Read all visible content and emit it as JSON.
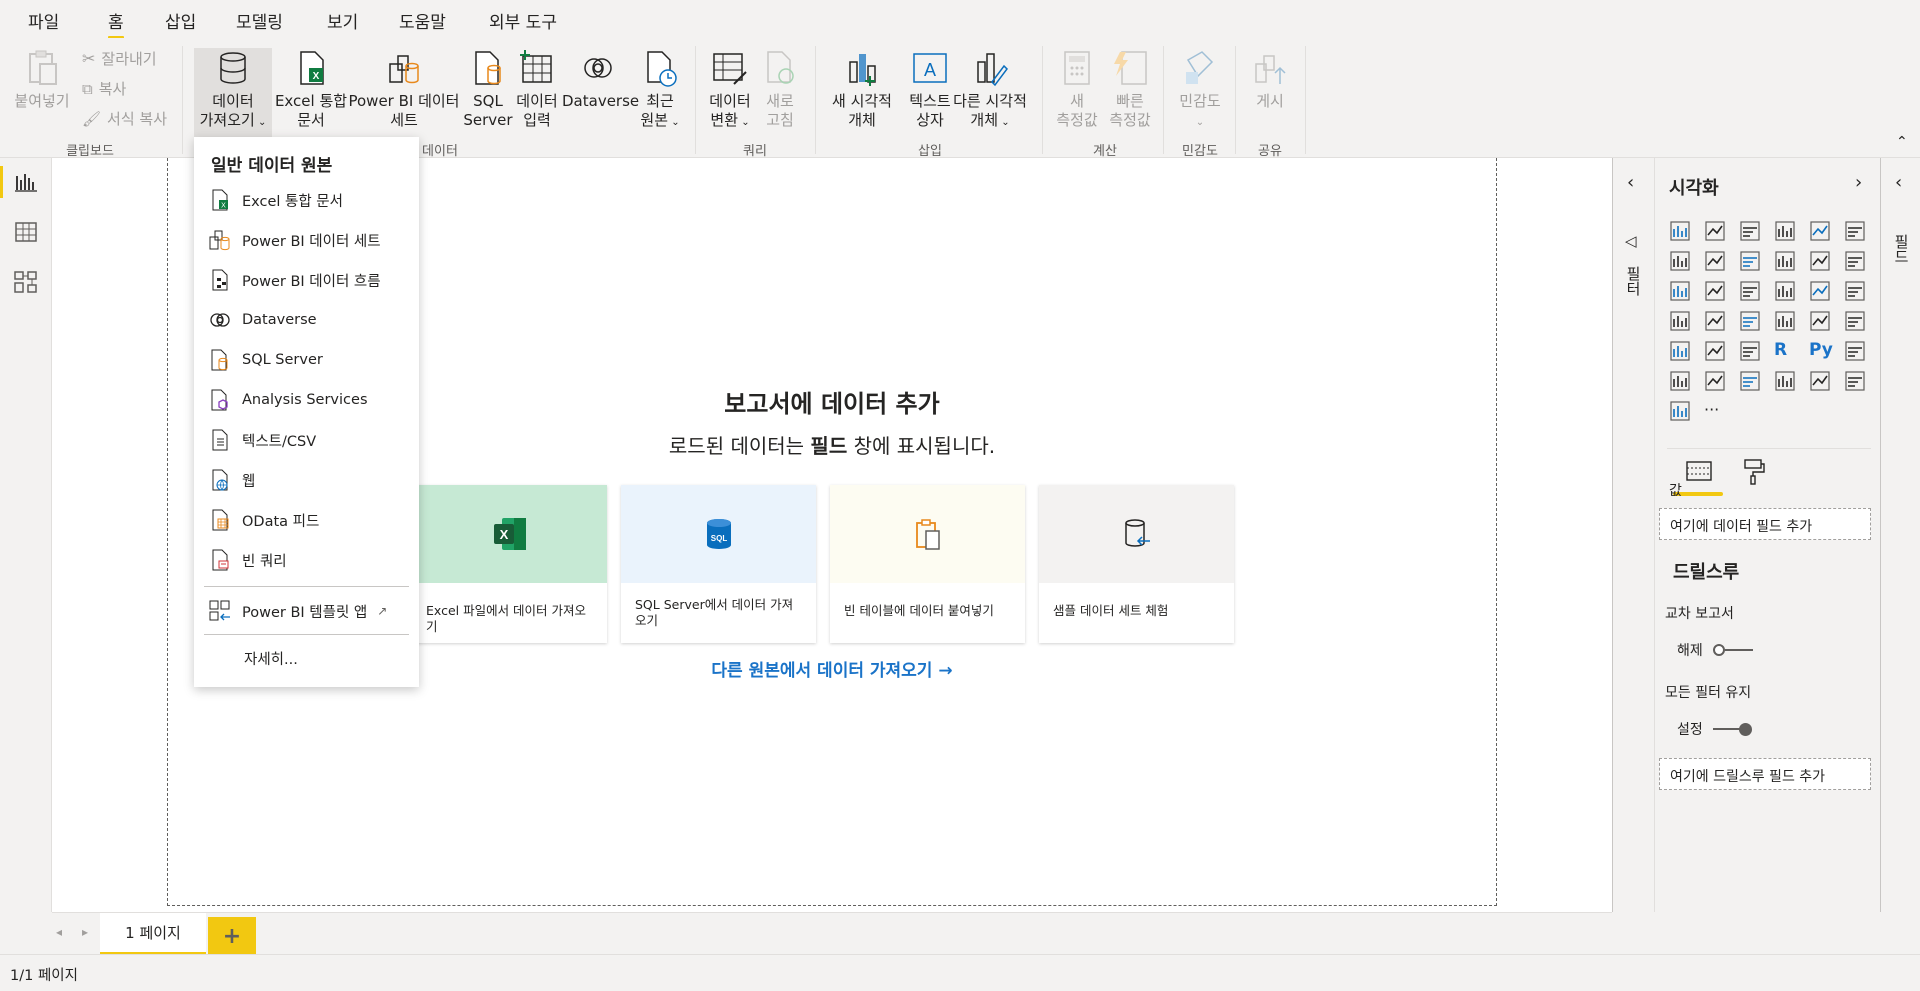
{
  "menubar": {
    "items": [
      "파일",
      "홈",
      "삽입",
      "모델링",
      "보기",
      "도움말",
      "외부 도구"
    ],
    "active": "홈"
  },
  "ribbon": {
    "clipboard": {
      "paste": "붙여넣기",
      "cut": "잘라내기",
      "copy": "복사",
      "format_painter": "서식 복사",
      "group_label": "클립보드"
    },
    "data": {
      "get_data_line1": "데이터",
      "get_data_line2": "가져오기",
      "excel_line1": "Excel 통합",
      "excel_line2": "문서",
      "pbi_line1": "Power BI 데이터",
      "pbi_line2": "세트",
      "sql_line1": "SQL",
      "sql_line2": "Server",
      "enter_line1": "데이터",
      "enter_line2": "입력",
      "dataverse": "Dataverse",
      "recent_line1": "최근",
      "recent_line2": "원본",
      "group_label": "데이터"
    },
    "queries": {
      "transform_line1": "데이터",
      "transform_line2": "변환",
      "refresh_line1": "새로",
      "refresh_line2": "고침",
      "group_label": "쿼리"
    },
    "insert": {
      "new_visual_line1": "새 시각적",
      "new_visual_line2": "개체",
      "textbox_line1": "텍스트",
      "textbox_line2": "상자",
      "more_visuals_line1": "다른 시각적",
      "more_visuals_line2": "개체",
      "group_label": "삽입"
    },
    "calculations": {
      "new_measure_line1": "새",
      "new_measure_line2": "측정값",
      "quick_measure_line1": "빠른",
      "quick_measure_line2": "측정값",
      "group_label": "계산"
    },
    "sensitivity": {
      "label": "민감도",
      "group_label": "민감도"
    },
    "share": {
      "publish": "게시",
      "group_label": "공유"
    }
  },
  "dropdown": {
    "header": "일반 데이터 원본",
    "items": [
      "Excel 통합 문서",
      "Power BI 데이터 세트",
      "Power BI 데이터 흐름",
      "Dataverse",
      "SQL Server",
      "Analysis Services",
      "텍스트/CSV",
      "웹",
      "OData 피드",
      "빈 쿼리"
    ],
    "template_app": "Power BI 템플릿 앱",
    "more": "자세히..."
  },
  "canvas": {
    "title": "보고서에 데이터 추가",
    "subtitle_pre": "로드된 데이터는",
    "subtitle_bold": "필드",
    "subtitle_post": "창에 표시됩니다.",
    "cards": [
      {
        "label": "Excel 파일에서 데이터 가져오기",
        "color": "#c6e9d4"
      },
      {
        "label": "SQL Server에서 데이터 가져오기",
        "color": "#eaf3fc"
      },
      {
        "label": "빈 테이블에 데이터 붙여넣기",
        "color": "#fdfcf2"
      },
      {
        "label": "샘플 데이터 세트 체험",
        "color": "#f3f2f1"
      }
    ],
    "other_sources": "다른 원본에서 데이터 가져오기 →",
    "sql_badge": "SQL"
  },
  "filters": {
    "label": "필터"
  },
  "visualizations": {
    "title": "시각화",
    "values_label": "값",
    "values_placeholder": "여기에 데이터 필드 추가",
    "drillthrough_title": "드릴스루",
    "cross_report": "교차 보고서",
    "cross_report_state": "해제",
    "keep_filters": "모든 필터 유지",
    "keep_filters_state": "설정",
    "drill_placeholder": "여기에 드릴스루 필드 추가",
    "r_label": "R",
    "py_label": "Py",
    "more": "···"
  },
  "fields": {
    "label": "필드"
  },
  "pages": {
    "tab": "1 페이지",
    "add": "+"
  },
  "status": {
    "text": "1/1 페이지"
  },
  "colors": {
    "accent": "#f2c811",
    "link": "#1a73c8",
    "excel_green": "#107c41",
    "sql_blue": "#0a6ebd",
    "orange": "#e8891c"
  }
}
